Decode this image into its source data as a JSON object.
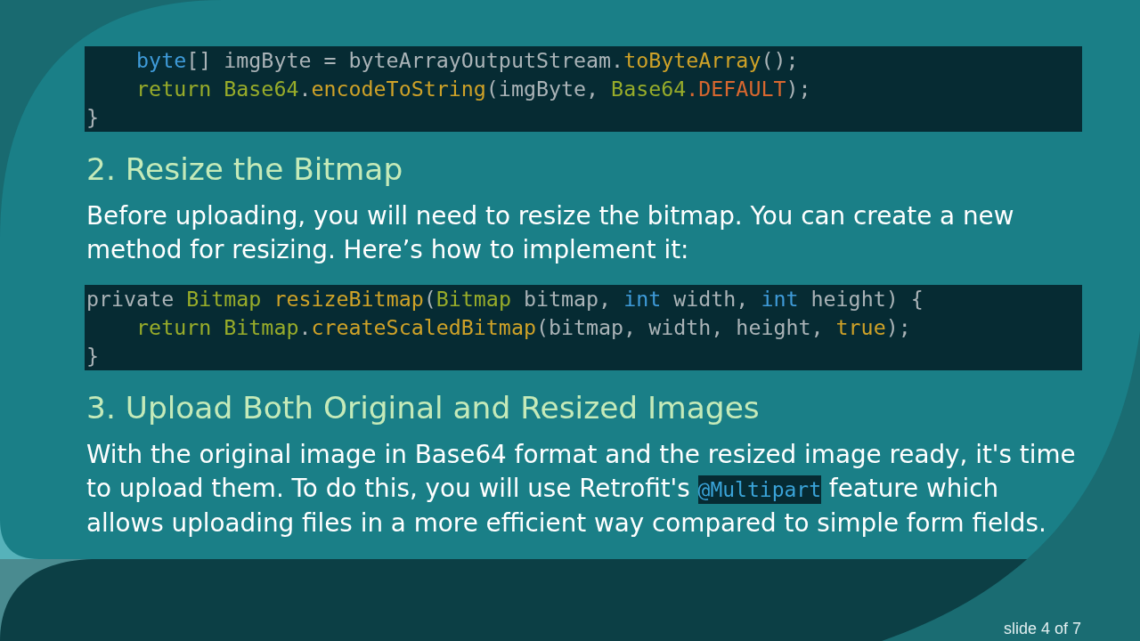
{
  "content": [
    {
      "kind": "code",
      "lines": [
        {
          "children": [
            {
              "tokens": [
                {
                  "kind": "keyword",
                  "text": "byte"
                },
                {
                  "kind": "plain",
                  "text": "[] imgByte = byteArrayOutputStream."
                },
                {
                  "kind": "method",
                  "text": "toByteArray"
                },
                {
                  "kind": "plain",
                  "text": "();"
                }
              ]
            },
            {
              "tokens": [
                {
                  "kind": "control",
                  "text": "return "
                },
                {
                  "kind": "type",
                  "text": "Base64"
                },
                {
                  "kind": "plain",
                  "text": "."
                },
                {
                  "kind": "method",
                  "text": "encodeToString"
                },
                {
                  "kind": "plain",
                  "text": "(imgByte, "
                },
                {
                  "kind": "type",
                  "text": "Base64"
                },
                {
                  "kind": "constant",
                  "text": ".DEFAULT"
                },
                {
                  "kind": "plain",
                  "text": ");"
                }
              ]
            }
          ]
        },
        {
          "tokens": [
            {
              "kind": "plain",
              "text": "}"
            }
          ]
        }
      ]
    },
    {
      "kind": "heading",
      "text": "2. Resize the Bitmap"
    },
    {
      "kind": "paragraph",
      "segments": [
        {
          "kind": "text",
          "text": "Before uploading, you will need to resize the bitmap. You can create a new method for resizing. Here’s how to implement it:"
        }
      ]
    },
    {
      "kind": "code",
      "lines": [
        {
          "tokens": [
            {
              "kind": "plain",
              "text": "private "
            },
            {
              "kind": "type",
              "text": "Bitmap "
            },
            {
              "kind": "method",
              "text": "resizeBitmap"
            },
            {
              "kind": "plain",
              "text": "("
            },
            {
              "kind": "type",
              "text": "Bitmap"
            },
            {
              "kind": "plain",
              "text": " bitmap, "
            },
            {
              "kind": "keyword",
              "text": "int"
            },
            {
              "kind": "plain",
              "text": " width, "
            },
            {
              "kind": "keyword",
              "text": "int"
            },
            {
              "kind": "plain",
              "text": " height) {"
            }
          ],
          "children": [
            {
              "tokens": [
                {
                  "kind": "control",
                  "text": "return "
                },
                {
                  "kind": "type",
                  "text": "Bitmap"
                },
                {
                  "kind": "plain",
                  "text": "."
                },
                {
                  "kind": "method",
                  "text": "createScaledBitmap"
                },
                {
                  "kind": "plain",
                  "text": "(bitmap, width, height, "
                },
                {
                  "kind": "literal",
                  "text": "true"
                },
                {
                  "kind": "plain",
                  "text": ");"
                }
              ]
            }
          ]
        },
        {
          "tokens": [
            {
              "kind": "plain",
              "text": "}"
            }
          ]
        }
      ]
    },
    {
      "kind": "heading",
      "text": "3. Upload Both Original and Resized Images"
    },
    {
      "kind": "paragraph",
      "segments": [
        {
          "kind": "text",
          "text": "With the original image in Base64 format and the resized image ready, it's time to upload them. To do this, you will use Retrofit's "
        },
        {
          "kind": "code",
          "text": "@Multipart"
        },
        {
          "kind": "text",
          "text": " feature which allows uploading files in a more efficient way compared to simple form fields."
        }
      ]
    }
  ],
  "footer": {
    "slide_number": "slide 4 of 7"
  }
}
